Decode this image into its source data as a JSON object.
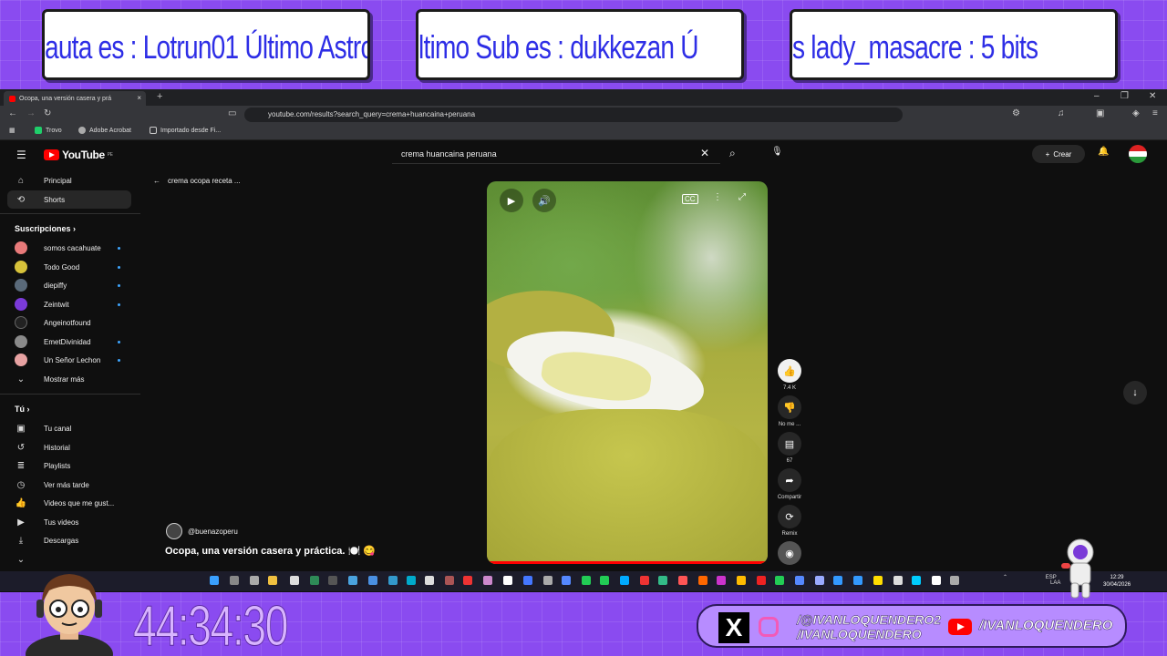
{
  "banners": {
    "b1": "auta es : Lotrun01    Último Astron",
    "b2": "ltimo Sub es : dukkezan       Ú",
    "b3": "s        lady_masacre : 5 bits"
  },
  "browser": {
    "tab_title": "Ocopa, una versión casera y prá",
    "url": "youtube.com/results?search_query=crema+huancaina+peruana",
    "bookmarks": [
      "Trovo",
      "Adobe Acrobat",
      "Importado desde Fi..."
    ]
  },
  "youtube": {
    "logo_text": "YouTube",
    "logo_region": "PE",
    "search_value": "crema huancaina peruana",
    "create_label": "Crear",
    "sidebar": {
      "principal": "Principal",
      "shorts": "Shorts",
      "subs_title": "Suscripciones",
      "subs": [
        "somos cacahuate",
        "Todo Good",
        "diepiffy",
        "Zeintwit",
        "Angeinotfound",
        "EmetDivinidad",
        "Un Señor Lechon"
      ],
      "show_more": "Mostrar más",
      "you_title": "Tú",
      "you_items": [
        "Tu canal",
        "Historial",
        "Playlists",
        "Ver más tarde",
        "Videos que me gust...",
        "Tus videos",
        "Descargas"
      ]
    },
    "back_label": "crema ocopa receta ...",
    "short": {
      "channel": "@buenazoperu",
      "title": "Ocopa, una versión casera y práctica. 🍽️ 😋",
      "likes": "7.4 K",
      "dislike_label": "No me ...",
      "comments": "67",
      "share_label": "Compartir",
      "remix_label": "Remix"
    }
  },
  "taskbar": {
    "lang": "ESP",
    "lang2": "LAA",
    "time": "12:29",
    "date": "30/04/2026"
  },
  "overlay": {
    "timer": "44:34:30",
    "handle_x1": "/@IVANLOQUENDERO2",
    "handle_x2": "/IVANLOQUENDERO",
    "handle_yt": "/IVANLOQUENDERO"
  }
}
